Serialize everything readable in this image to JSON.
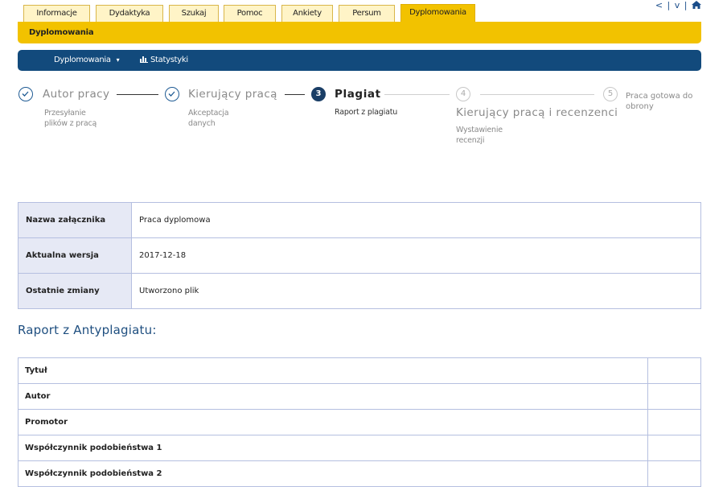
{
  "tabs": [
    {
      "label": "Informacje",
      "active": false
    },
    {
      "label": "Dydaktyka",
      "active": false
    },
    {
      "label": "Szukaj",
      "active": false
    },
    {
      "label": "Pomoc",
      "active": false
    },
    {
      "label": "Ankiety",
      "active": false
    },
    {
      "label": "Persum",
      "active": false
    },
    {
      "label": "Dyplomowania",
      "active": true
    }
  ],
  "top_right": {
    "prev": "<",
    "sep1": "|",
    "down": "v",
    "sep2": "|",
    "home_icon": "home-icon"
  },
  "section_title": "Dyplomowania",
  "submenu": {
    "item1": "Dyplomowania",
    "item1_caret": "▾",
    "item2": "Statystyki",
    "item2_icon": "bar-chart-icon"
  },
  "steps": [
    {
      "title": "Autor pracy",
      "sub": [
        "Przesyłanie",
        "plików z pracą"
      ],
      "state": "done"
    },
    {
      "title": "Kierujący pracą",
      "sub": [
        "Akceptacja",
        "danych"
      ],
      "state": "done"
    },
    {
      "number": "3",
      "title": "Plagiat",
      "sub": [
        "Raport z plagiatu"
      ],
      "state": "active"
    },
    {
      "number": "4",
      "title": "Kierujący pracą i recenzenci",
      "sub": [
        "Wystawienie",
        "recenzji"
      ],
      "state": "future"
    },
    {
      "number": "5",
      "title": [
        "Praca gotowa do",
        "obrony"
      ],
      "state": "future"
    }
  ],
  "info": [
    {
      "label": "Nazwa załącznika",
      "value": "Praca dyplomowa"
    },
    {
      "label": "Aktualna wersja",
      "value": "2017-12-18"
    },
    {
      "label": "Ostatnie zmiany",
      "value": "Utworzono plik"
    }
  ],
  "report_title": "Raport z Antyplagiatu:",
  "report_rows": [
    {
      "label": "Tytuł",
      "value": ""
    },
    {
      "label": "Autor",
      "value": ""
    },
    {
      "label": "Promotor",
      "value": ""
    },
    {
      "label": "Współczynnik podobieństwa 1",
      "value": ""
    },
    {
      "label": "Współczynnik podobieństwa 2",
      "value": ""
    }
  ],
  "colors": {
    "yellow": "#f2c200",
    "navy": "#124a7c",
    "table_border": "#b5bfe0",
    "label_bg": "#e6e9f5"
  }
}
